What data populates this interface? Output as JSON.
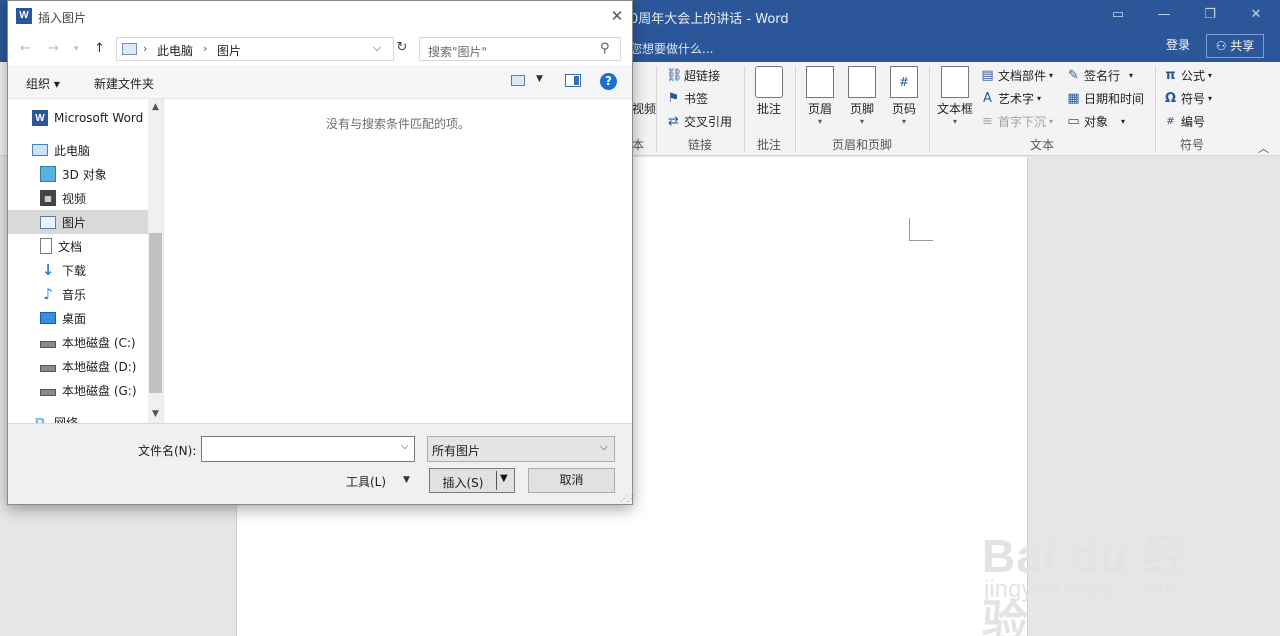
{
  "word": {
    "title": "0周年大会上的讲话 - Word",
    "tell_me": "您想要做什么...",
    "login": "登录",
    "share": "共享",
    "ribbon": {
      "links_group": "链接",
      "comments_group": "批注",
      "header_footer_group": "页眉和页脚",
      "text_group": "文本",
      "symbols_group": "符号",
      "partial_group_label": "本",
      "partial_video": "视频",
      "hyperlink": "超链接",
      "bookmark": "书签",
      "cross_reference": "交叉引用",
      "comment": "批注",
      "header": "页眉",
      "footer": "页脚",
      "page_number": "页码",
      "text_box": "文本框",
      "quick_parts": "文档部件",
      "wordart": "艺术字",
      "drop_cap": "首字下沉",
      "signature_line": "签名行",
      "date_time": "日期和时间",
      "object": "对象",
      "equation": "公式",
      "symbol": "符号",
      "number": "编号"
    }
  },
  "dialog": {
    "title": "插入图片",
    "breadcrumb": [
      "此电脑",
      "图片"
    ],
    "search_placeholder": "搜索\"图片\"",
    "toolbar": {
      "organize": "组织 ▾",
      "new_folder": "新建文件夹"
    },
    "nav_items": [
      {
        "label": "Microsoft Word",
        "icon": "word-icon"
      },
      {
        "label": "此电脑",
        "icon": "computer-icon"
      },
      {
        "label": "3D 对象",
        "icon": "3d-objects-icon"
      },
      {
        "label": "视频",
        "icon": "video-icon"
      },
      {
        "label": "图片",
        "icon": "pictures-icon",
        "selected": true
      },
      {
        "label": "文档",
        "icon": "documents-icon"
      },
      {
        "label": "下载",
        "icon": "download-icon"
      },
      {
        "label": "音乐",
        "icon": "music-icon"
      },
      {
        "label": "桌面",
        "icon": "desktop-icon"
      },
      {
        "label": "本地磁盘 (C:)",
        "icon": "drive-icon"
      },
      {
        "label": "本地磁盘 (D:)",
        "icon": "drive-icon"
      },
      {
        "label": "本地磁盘 (G:)",
        "icon": "drive-icon"
      },
      {
        "label": "网络",
        "icon": "network-icon"
      }
    ],
    "empty_message": "没有与搜索条件匹配的项。",
    "filename_label": "文件名(N):",
    "filename_value": "",
    "file_type": "所有图片",
    "tools": "工具(L)",
    "insert": "插入(S)",
    "cancel": "取消"
  },
  "watermark": {
    "logo": "Bai du 经验",
    "url": "jingyan.baidu.com"
  },
  "colors": {
    "word_blue": "#2b579a",
    "nav_selected": "#d9d9d9",
    "help_blue": "#1f6fd0"
  }
}
